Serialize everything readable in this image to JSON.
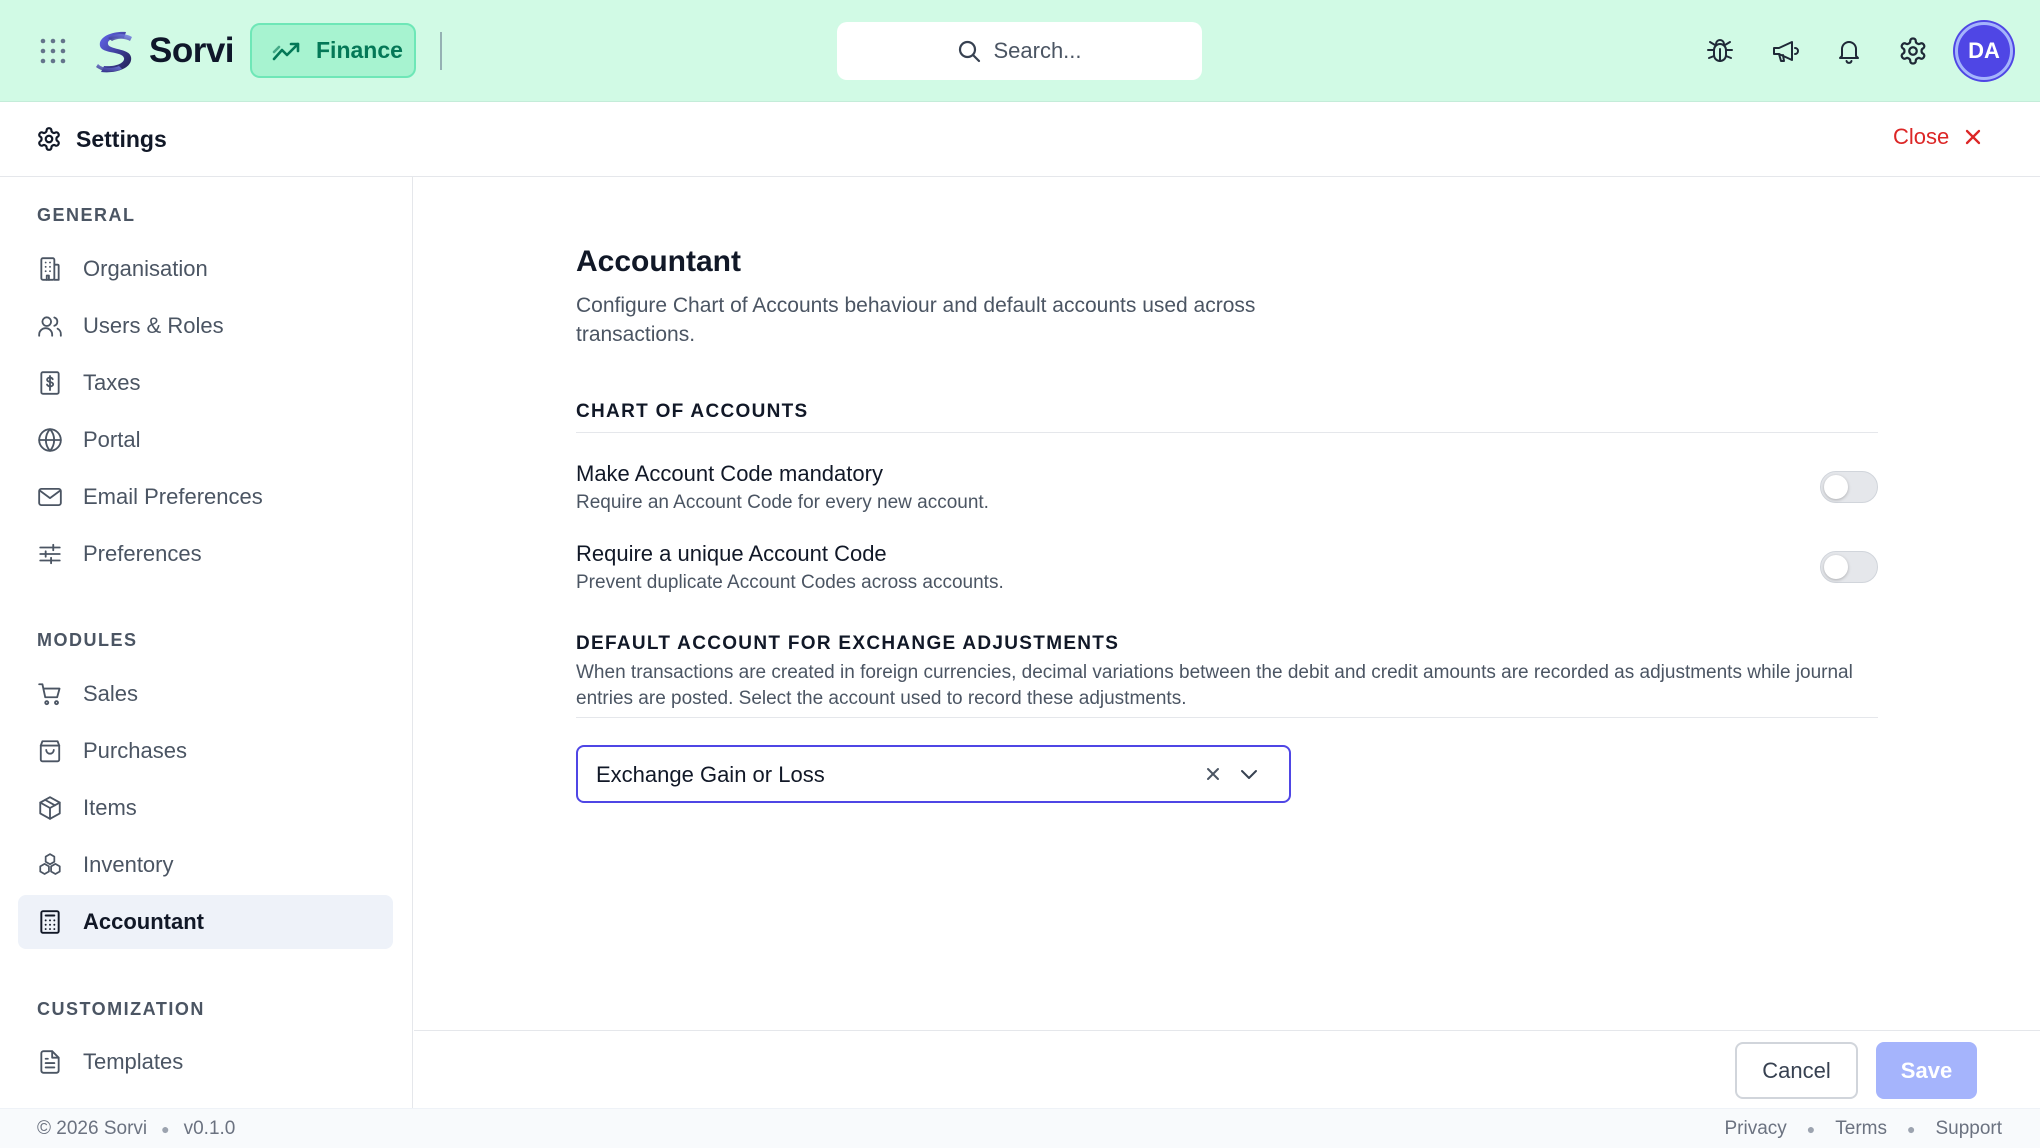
{
  "topbar": {
    "brand": "Sorvi",
    "module": "Finance",
    "search_placeholder": "Search...",
    "avatar_initials": "DA",
    "background": "#d1fae5"
  },
  "settings_header": {
    "title": "Settings",
    "close_label": "Close"
  },
  "sidebar": {
    "groups": [
      {
        "label": "GENERAL",
        "items": [
          {
            "label": "Organisation",
            "icon": "building-icon"
          },
          {
            "label": "Users & Roles",
            "icon": "users-icon"
          },
          {
            "label": "Taxes",
            "icon": "receipt-dollar-icon"
          },
          {
            "label": "Portal",
            "icon": "globe-icon"
          },
          {
            "label": "Email Preferences",
            "icon": "mail-icon"
          },
          {
            "label": "Preferences",
            "icon": "sliders-icon"
          }
        ]
      },
      {
        "label": "MODULES",
        "items": [
          {
            "label": "Sales",
            "icon": "cart-icon"
          },
          {
            "label": "Purchases",
            "icon": "shopping-bag-icon"
          },
          {
            "label": "Items",
            "icon": "package-icon"
          },
          {
            "label": "Inventory",
            "icon": "boxes-icon"
          },
          {
            "label": "Accountant",
            "icon": "calculator-icon",
            "active": true
          }
        ]
      },
      {
        "label": "CUSTOMIZATION",
        "items": [
          {
            "label": "Templates",
            "icon": "file-text-icon"
          }
        ]
      }
    ]
  },
  "main": {
    "title": "Accountant",
    "description": "Configure Chart of Accounts behaviour and default accounts used across transactions.",
    "chart_section": {
      "title": "CHART OF ACCOUNTS",
      "settings": [
        {
          "title": "Make Account Code mandatory",
          "description": "Require an Account Code for every new account.",
          "enabled": false
        },
        {
          "title": "Require a unique Account Code",
          "description": "Prevent duplicate Account Codes across accounts.",
          "enabled": false
        }
      ]
    },
    "exchange_section": {
      "title": "DEFAULT ACCOUNT FOR EXCHANGE ADJUSTMENTS",
      "description": "When transactions are created in foreign currencies, decimal variations between the debit and credit amounts are recorded as adjustments while journal entries are posted. Select the account used to record these adjustments.",
      "selected_account": "Exchange Gain or Loss"
    }
  },
  "actions": {
    "cancel_label": "Cancel",
    "save_label": "Save"
  },
  "footer": {
    "copyright": "© 2026 Sorvi",
    "version": "v0.1.0",
    "links": [
      "Privacy",
      "Terms",
      "Support"
    ]
  },
  "colors": {
    "accent": "#4f46e5",
    "brand_green": "#047857",
    "danger": "#dc2626",
    "save_disabled": "#a5b4fc"
  }
}
